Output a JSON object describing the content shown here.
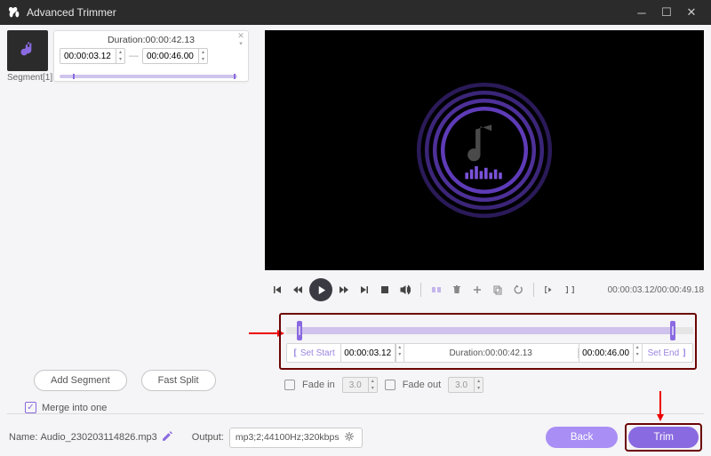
{
  "window": {
    "title": "Advanced Trimmer"
  },
  "segment": {
    "label": "Segment[1]",
    "duration_label": "Duration:00:00:42.13",
    "start": "00:00:03.12",
    "end": "00:00:46.00"
  },
  "left_buttons": {
    "add_segment": "Add Segment",
    "fast_split": "Fast Split"
  },
  "merge": {
    "label": "Merge into one",
    "checked": true
  },
  "player": {
    "time_current": "00:00:03.12",
    "time_total": "00:00:49.18"
  },
  "timeline": {
    "set_start": "Set Start",
    "set_end": "Set End",
    "start": "00:00:03.12",
    "end": "00:00:46.00",
    "duration_label": "Duration:00:00:42.13"
  },
  "fade": {
    "in_label": "Fade in",
    "in_value": "3.0",
    "out_label": "Fade out",
    "out_value": "3.0"
  },
  "footer": {
    "name_label": "Name:",
    "name_value": "Audio_230203114826.mp3",
    "output_label": "Output:",
    "output_value": "mp3;2;44100Hz;320kbps",
    "back": "Back",
    "trim": "Trim"
  },
  "colors": {
    "accent": "#8a6ae0"
  }
}
